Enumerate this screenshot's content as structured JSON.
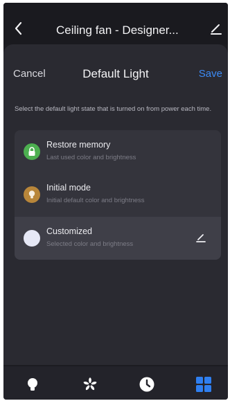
{
  "header": {
    "title": "Ceiling fan - Designer..."
  },
  "sheet": {
    "cancel_label": "Cancel",
    "title": "Default Light",
    "save_label": "Save",
    "description": "Select the default light state that is turned on from power each time."
  },
  "options": [
    {
      "title": "Restore memory",
      "subtitle": "Last used color and brightness",
      "icon": "lock-icon",
      "color": "#4caf50"
    },
    {
      "title": "Initial mode",
      "subtitle": "Initial default color and brightness",
      "icon": "lightbulb-icon",
      "color": "#b8863a"
    },
    {
      "title": "Customized",
      "subtitle": "Selected color and brightness",
      "icon": "color-swatch",
      "color": "#e6e8f6",
      "selected": true
    }
  ],
  "nav": {
    "items": [
      "light-tab",
      "fan-tab",
      "schedule-tab",
      "more-tab"
    ],
    "active": "more-tab",
    "accent": "#2f7ff0"
  }
}
